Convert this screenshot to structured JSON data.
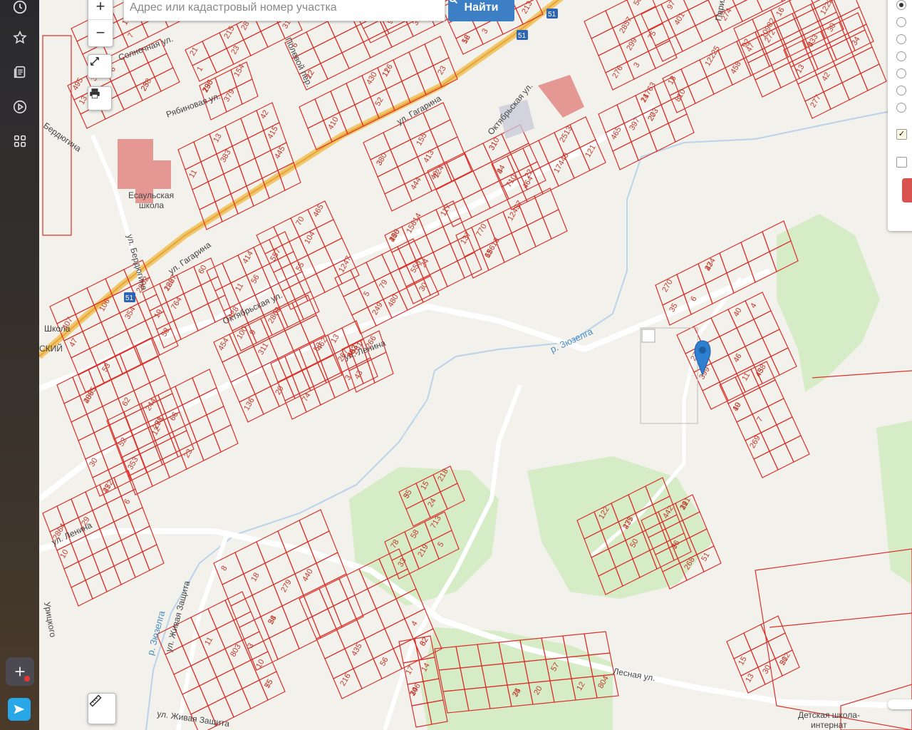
{
  "search": {
    "placeholder": "Адрес или кадастровый номер участка",
    "button_label": "Найти"
  },
  "zoom": {
    "in_label": "+",
    "out_label": "−"
  },
  "panel": {
    "radio_count": 7,
    "selected_index": 0,
    "checkbox1_checked": true,
    "checkbox2_checked": false,
    "check_mark": "✓"
  },
  "streets": [
    {
      "name": "ул. Гагарина"
    },
    {
      "name": "ул. Гагарина"
    },
    {
      "name": "Октябрьская ул."
    },
    {
      "name": "Октябрьская ул."
    },
    {
      "name": "ул. Ленина"
    },
    {
      "name": "ул. Ленина"
    },
    {
      "name": "ул. Бердюгина"
    },
    {
      "name": "Бердюгина"
    },
    {
      "name": "Рябиновая ул."
    },
    {
      "name": "Солнечная ул."
    },
    {
      "name": "Полевой пер."
    },
    {
      "name": "Лесная ул."
    },
    {
      "name": "ул. Живая Защита"
    },
    {
      "name": "ул. Живая Защита"
    },
    {
      "name": "Урицкого"
    },
    {
      "name": "Парижская"
    }
  ],
  "rivers": [
    {
      "name": "р. Зюзелга"
    },
    {
      "name": "р. Зюзелга"
    }
  ],
  "pois": [
    {
      "name": "Есаульская школа"
    },
    {
      "name": "Школа"
    },
    {
      "name": "Детская школа-интернат"
    },
    {
      "name": "СКИЙ"
    }
  ],
  "route_badges": [
    "51",
    "51",
    "51"
  ],
  "parcel_numbers": [
    "477",
    "495",
    "23",
    "22",
    "25",
    "3",
    "126",
    "13",
    "154",
    "155",
    "124",
    "121",
    "137",
    "117",
    "79",
    "104",
    "100",
    "122",
    "106",
    "30",
    "29",
    "136",
    "74",
    "68",
    "66",
    "75",
    "97",
    "92",
    "465",
    "30",
    "34",
    "27",
    "11",
    "7",
    "122",
    "121",
    "54",
    "62",
    "55",
    "57",
    "58",
    "5",
    "17",
    "50",
    "7",
    "13",
    "28",
    "12",
    "5",
    "808",
    "410",
    "415",
    "795",
    "413",
    "710",
    "464",
    "770",
    "416",
    "480",
    "465",
    "414",
    "764",
    "407",
    "409",
    "452",
    "454",
    "462",
    "463",
    "271",
    "276",
    "274",
    "458",
    "273",
    "272",
    "277",
    "270",
    "278",
    "269",
    "275",
    "268",
    "279",
    "216",
    "803",
    "804",
    "219",
    "218",
    "206",
    "212",
    "214",
    "238",
    "215",
    "429",
    "207",
    "213",
    "430",
    "445",
    "296",
    "444",
    "310",
    "2513",
    "15613",
    "15614",
    "558",
    "557",
    "428",
    "58",
    "53",
    "62",
    "27",
    "311",
    "281",
    "307",
    "298",
    "299",
    "297",
    "810",
    "397",
    "443",
    "433",
    "434",
    "399",
    "438",
    "437",
    "442",
    "440",
    "435",
    "75",
    "75",
    "713",
    "35",
    "34",
    "30",
    "18",
    "33",
    "31",
    "32",
    "66",
    "56",
    "23",
    "383",
    "379",
    "380",
    "22",
    "17440",
    "12457",
    "250",
    "249",
    "1247",
    "2863",
    "2867",
    "2862",
    "2865",
    "2864",
    "20",
    "267",
    "266",
    "244",
    "2857",
    "401",
    "10982",
    "20",
    "16",
    "13",
    "3",
    "40",
    "49",
    "50",
    "51",
    "8",
    "32",
    "10",
    "20",
    "78",
    "15",
    "14",
    "13",
    "459",
    "25",
    "21",
    "6",
    "3",
    "53",
    "52",
    "11",
    "13",
    "3",
    "7",
    "8",
    "63",
    "24",
    "30",
    "55",
    "56",
    "60",
    "354",
    "353",
    "10",
    "9",
    "3",
    "43",
    "52",
    "50",
    "56",
    "18",
    "21",
    "47",
    "42",
    "35",
    "46",
    "45",
    "36",
    "29",
    "18",
    "4",
    "3",
    "34",
    "33",
    "24",
    "14",
    "15",
    "65",
    "6",
    "1",
    "5",
    "9",
    "12",
    "11",
    "42",
    "13",
    "40",
    "31",
    "44",
    "11",
    "10",
    "5",
    "70",
    "11",
    "19",
    "47",
    "12",
    "6",
    "53",
    "13",
    "30",
    "23",
    "3",
    "17",
    "12225",
    "14763",
    "12227",
    "8",
    "6",
    "4",
    "10",
    "7",
    "31",
    "28",
    "56",
    "11",
    "12",
    "5"
  ]
}
